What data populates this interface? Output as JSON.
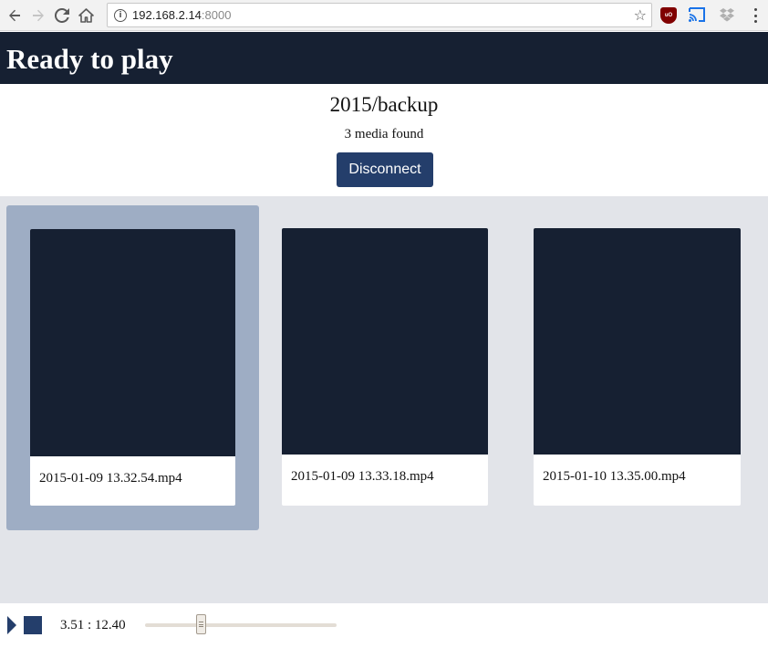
{
  "browser": {
    "url_host": "192.168.2.14",
    "url_port": ":8000",
    "icons": {
      "back": "arrow-left-icon",
      "forward": "arrow-right-icon",
      "reload": "reload-icon",
      "home": "home-icon",
      "info": "info-icon",
      "star": "star-icon",
      "ublock": "ublock-icon",
      "cast": "cast-icon",
      "dropbox": "dropbox-icon",
      "menu": "more-vert-icon"
    },
    "ublock_text": "uO"
  },
  "app": {
    "title": "Ready to play",
    "header_color": "#162032",
    "accent_color": "#243e6b"
  },
  "folder": {
    "name": "2015/backup",
    "media_count": "3 media found",
    "disconnect_label": "Disconnect"
  },
  "media": [
    {
      "filename": "2015-01-09 13.32.54.mp4",
      "selected": true
    },
    {
      "filename": "2015-01-09 13.33.18.mp4",
      "selected": false
    },
    {
      "filename": "2015-01-10 13.35.00.mp4",
      "selected": false
    }
  ],
  "player": {
    "time": "3.51 : 12.40",
    "position_fraction": 0.283
  }
}
